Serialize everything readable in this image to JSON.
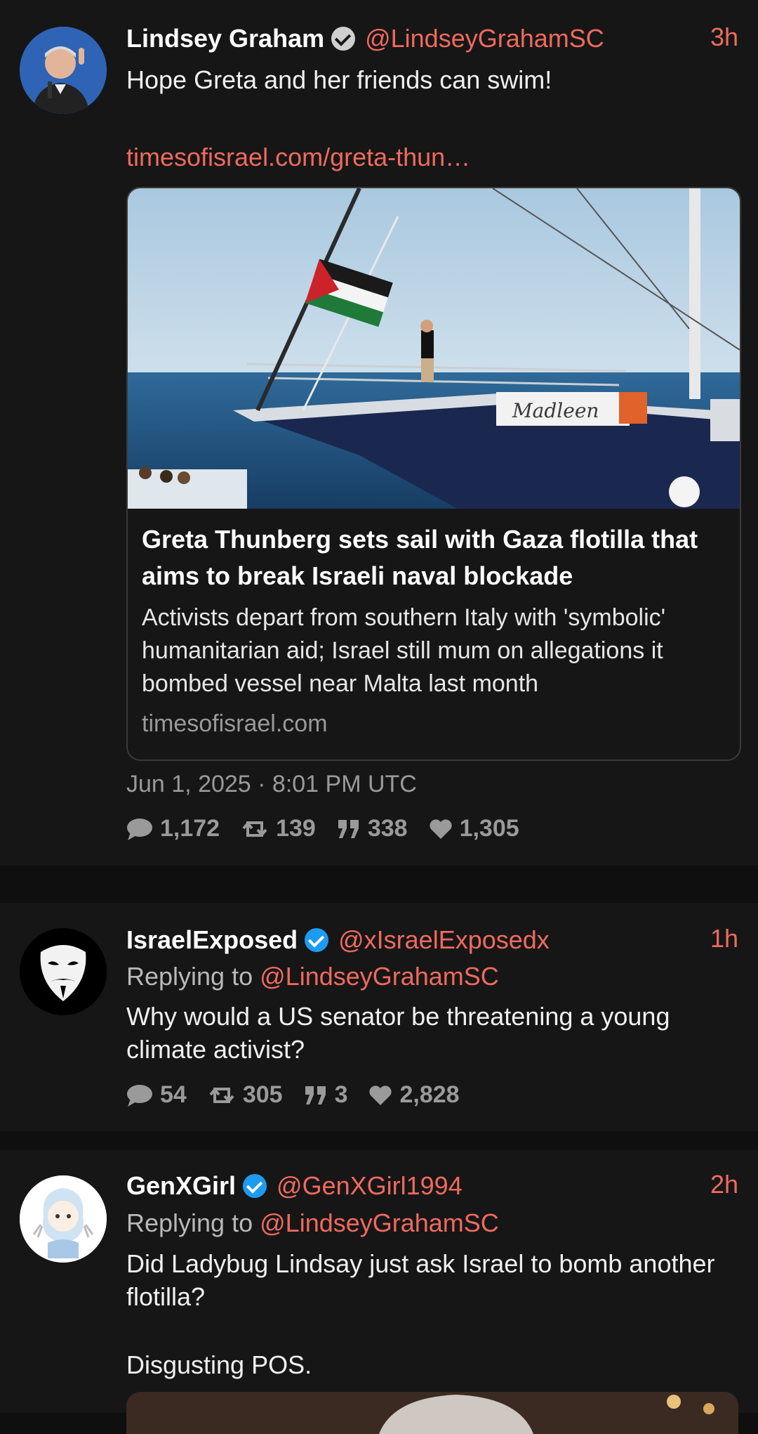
{
  "tweets": [
    {
      "name": "Lindsey Graham",
      "handle": "@LindseyGrahamSC",
      "time": "3h",
      "text": "Hope Greta and her friends can swim!",
      "link": "timesofisrael.com/greta-thun…",
      "card": {
        "title": "Greta Thunberg sets sail with Gaza flotilla that aims to break Israeli naval blockade",
        "description": "Activists depart from southern Italy with 'symbolic' humanitarian aid; Israel still mum on allegations it bombed vessel near Malta last month",
        "domain": "timesofisrael.com",
        "boat_name": "Madleen"
      },
      "date": "Jun 1, 2025 · 8:01 PM UTC",
      "stats": {
        "replies": "1,172",
        "retweets": "139",
        "quotes": "338",
        "likes": "1,305"
      }
    },
    {
      "name": "IsraelExposed",
      "handle": "@xIsraelExposedx",
      "time": "1h",
      "replying_label": "Replying to",
      "replying_to": "@LindseyGrahamSC",
      "text": "Why would a US senator be threatening a young climate activist?",
      "stats": {
        "replies": "54",
        "retweets": "305",
        "quotes": "3",
        "likes": "2,828"
      }
    },
    {
      "name": "GenXGirl",
      "handle": "@GenXGirl1994",
      "time": "2h",
      "replying_label": "Replying to",
      "replying_to": "@LindseyGrahamSC",
      "text": "Did Ladybug Lindsay just ask Israel to bomb another flotilla?",
      "text2": "Disgusting POS."
    }
  ],
  "colors": {
    "accent": "#ef6a5e",
    "verified": "#1d9bf0",
    "background": "#161616"
  }
}
